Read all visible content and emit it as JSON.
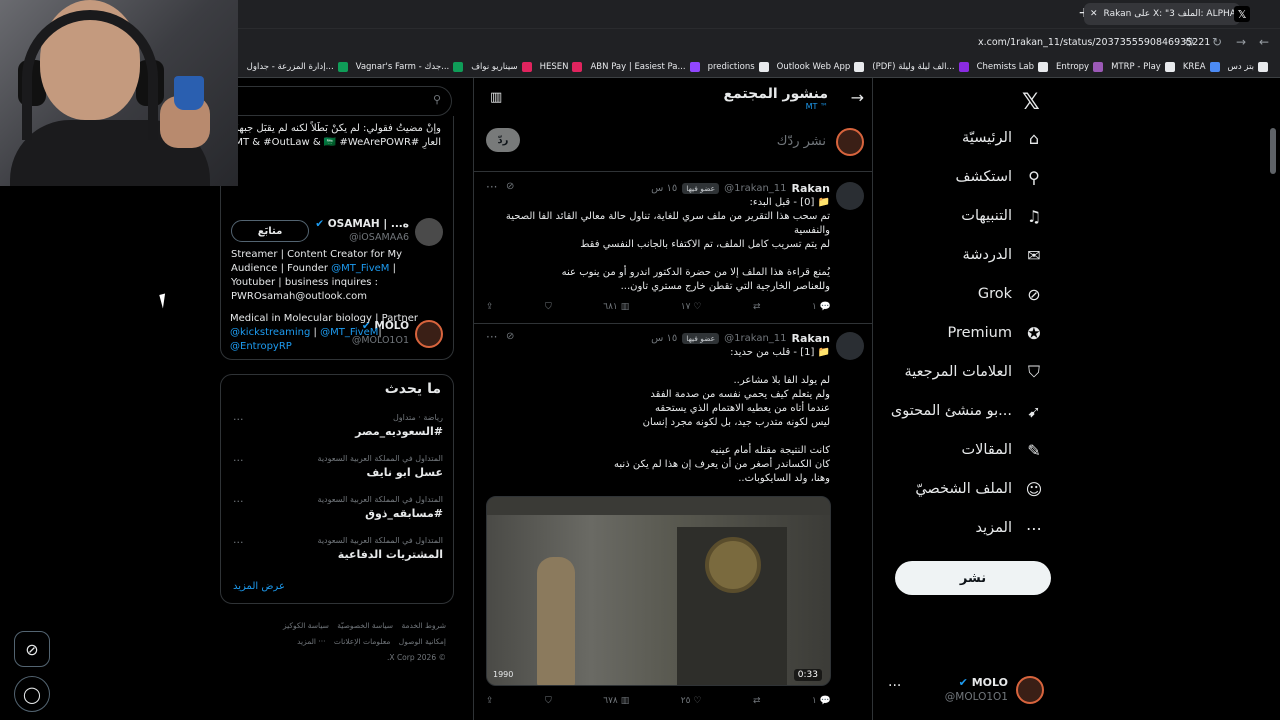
{
  "browser": {
    "tab_title": "Rakan على X: \"3 الملف: ALPHA",
    "url": "x.com/1rakan_11/status/2037355590846935221",
    "new_tab": "+",
    "tab_close": "✕",
    "bookmarks": [
      {
        "label": "بتز دس",
        "color": "#e8eaed"
      },
      {
        "label": "KREA",
        "color": "#4c8bf5"
      },
      {
        "label": "MTRP - Play",
        "color": "#e8eaed"
      },
      {
        "label": "Entropy",
        "color": "#9b59b6"
      },
      {
        "label": "Chemists Lab",
        "color": "#e8eaed"
      },
      {
        "label": "(PDF) الف ليلة وليلة...",
        "color": "#8a2be2"
      },
      {
        "label": "Outlook Web App",
        "color": "#e8eaed"
      },
      {
        "label": "predictions",
        "color": "#e8eaed"
      },
      {
        "label": "ABN Pay | Easiest Pa...",
        "color": "#9146ff"
      },
      {
        "label": "HESEN",
        "color": "#e0245e"
      },
      {
        "label": "سيناريو نواف",
        "color": "#e0245e"
      },
      {
        "label": "Vagnar's Farm - جدك...",
        "color": "#0f9d58"
      },
      {
        "label": "إدارة المزرعة - جداول...",
        "color": "#0f9d58"
      }
    ]
  },
  "nav": {
    "items": [
      {
        "label": "الرئيسيّة",
        "icon": "home-icon",
        "glyph": "⌂"
      },
      {
        "label": "استكشف",
        "icon": "search-icon",
        "glyph": "⚲"
      },
      {
        "label": "التنبيهات",
        "icon": "bell-icon",
        "glyph": "♫"
      },
      {
        "label": "الدردشة",
        "icon": "mail-icon",
        "glyph": "✉"
      },
      {
        "label": "Grok",
        "icon": "grok-icon",
        "glyph": "⊘"
      },
      {
        "label": "Premium",
        "icon": "premium-icon",
        "glyph": "✪"
      },
      {
        "label": "العلامات المرجعية",
        "icon": "bookmark-icon",
        "glyph": "⛉"
      },
      {
        "label": "...بو منشئ المحتوى",
        "icon": "rocket-icon",
        "glyph": "➹"
      },
      {
        "label": "المقالات",
        "icon": "articles-icon",
        "glyph": "✎"
      },
      {
        "label": "الملف الشخصيّ",
        "icon": "profile-icon",
        "glyph": "☺"
      },
      {
        "label": "المزيد",
        "icon": "more-icon",
        "glyph": "⋯"
      }
    ],
    "post_label": "نشر",
    "account_name": "MOLO",
    "account_handle": "@MOLO1O1"
  },
  "feed": {
    "title": "منشور المجتمع",
    "subtitle": "MT ™",
    "compose_placeholder": "نشر ردّك",
    "reply_button": "ردّ",
    "tweets": [
      {
        "name": "Rakan",
        "handle": "@1rakan_11",
        "badge": "عضو فيها",
        "time": "١٥ س",
        "text": "📁 [0] - قبل البدء:\nتم سحب هذا التقرير من ملف سري للغاية، تناول حالة معالي القائد الفا الصحية والنفسية\nلم يتم تسريب كامل الملف، تم الاكتفاء بالجانب النفسي فقط\n\nيُمنع قراءة هذا الملف إلا من حضرة الدكتور اندرو أو من ينوب عنه\nوللعناصر الخارجية التي تقطن خارج مستري تاون...",
        "replies": "١",
        "reposts": "",
        "likes": "١٧",
        "views": "٦٨١"
      },
      {
        "name": "Rakan",
        "handle": "@1rakan_11",
        "badge": "عضو فيها",
        "time": "١٥ س",
        "text": "📁 [1] - قلب من حديد:\n\nلم يولد الفا بلا مشاعر..\nولم يتعلم كيف يحمي نفسه من صدمة الفقد\nعندما أتاه من يعطيه الاهتمام الذي يستحقه\nليس لكونه متدرب جيد، بل لكونه مجرد إنسان\n\nكانت النتيجة مقتله أمام عينيه\nكان الكساندر أصغر من أن يعرف إن هذا لم يكن ذنبه\nوهنا، ولد السايكوبات..",
        "replies": "١",
        "reposts": "",
        "likes": "٢٥",
        "views": "٦٧٨",
        "media_year": "1990",
        "media_duration": "0:33"
      }
    ]
  },
  "sidebar": {
    "top_text": "وإنْ مضيتُ فقولي: لم يكنْ بَطَلاً لكنه لم يقبَل جبهةَ العارِ #MT & #OutLaw &\n🇸🇦 #WeArePOWR",
    "profiles": [
      {
        "name": "OSAMAH | ...ه",
        "handle": "@iOSAMAA6",
        "bio_plain": "Streamer | Content Creator for My Audience | Founder ",
        "bio_link1": "@MT_FiveM",
        "bio_rest": " | Youtuber | business inquires : PWROsamah@outlook.com",
        "follow_label": "متابَع"
      },
      {
        "name": "MOLO",
        "handle": "@MOLO1O1",
        "bio_plain": "Medical in Molecular biology | Partner ",
        "bio_link1": "@kickstreaming",
        "bio_sep": " | ",
        "bio_link2": "@MT_FiveM",
        "bio_sep2": "| ",
        "bio_link3": "@EntropyRP"
      }
    ],
    "trends_title": "ما يحدث",
    "trends": [
      {
        "meta": "رياضة · متداول",
        "name": "#السعوديه_مصر"
      },
      {
        "meta": "المتداول في المملكة العربية السعودية",
        "name": "عسل ابو نايف"
      },
      {
        "meta": "المتداول في المملكة العربية السعودية",
        "name": "#مسابقه_ذوق"
      },
      {
        "meta": "المتداول في المملكة العربية السعودية",
        "name": "المشتريات الدفاعية"
      }
    ],
    "show_more": "عرض المزيد",
    "footer_links": [
      "شروط الخدمة",
      "سياسة الخصوصيّة",
      "سياسة الكوكيز",
      "إمكانية الوصول",
      "معلومات الإعلانات",
      "··· المزيد"
    ],
    "copyright": "© 2026 X Corp."
  },
  "colors": {
    "accent": "#1d9bf0",
    "background": "#000000",
    "border": "#2f3336"
  }
}
